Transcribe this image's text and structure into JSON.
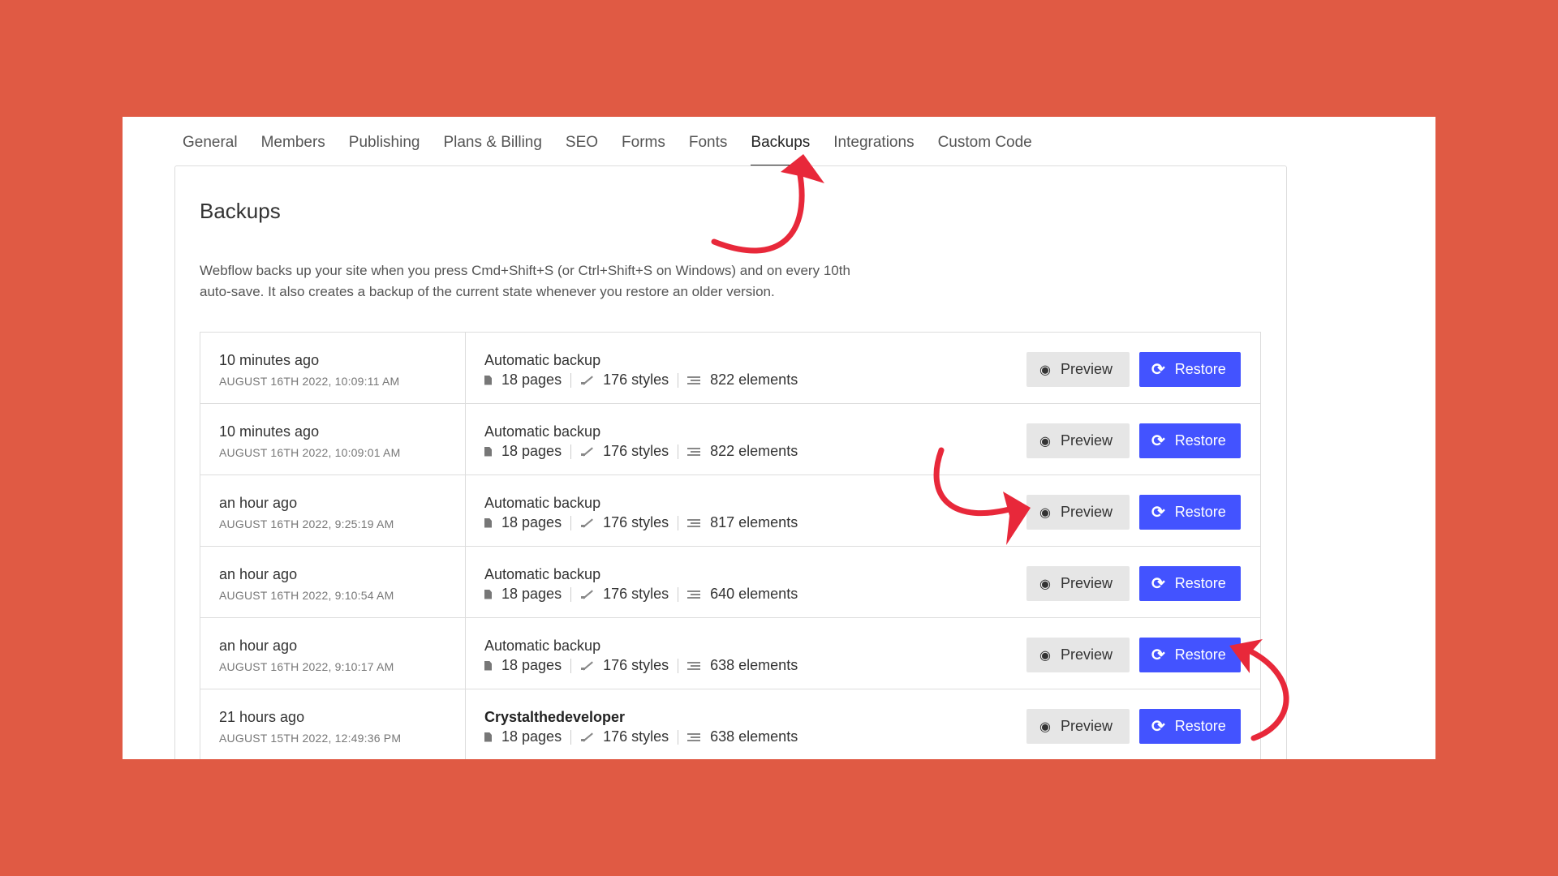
{
  "tabs": [
    "General",
    "Members",
    "Publishing",
    "Plans & Billing",
    "SEO",
    "Forms",
    "Fonts",
    "Backups",
    "Integrations",
    "Custom Code"
  ],
  "active_tab": "Backups",
  "heading": "Backups",
  "description": "Webflow backs up your site when you press Cmd+Shift+S (or Ctrl+Shift+S on Windows) and on every 10th auto-save. It also creates a backup of the current state whenever you restore an older version.",
  "buttons": {
    "preview": "Preview",
    "restore": "Restore"
  },
  "icons": {
    "preview": "eye-icon",
    "restore": "rotate-icon",
    "pages": "page-icon",
    "styles": "brush-icon",
    "elements": "list-icon"
  },
  "colors": {
    "background": "#E05A44",
    "primary": "#4353FF",
    "annotation": "#E8283A"
  },
  "backups": [
    {
      "relative": "10 minutes ago",
      "timestamp": "AUGUST 16TH 2022, 10:09:11 AM",
      "title": "Automatic backup",
      "bold": false,
      "pages": "18 pages",
      "styles": "176 styles",
      "elements": "822 elements"
    },
    {
      "relative": "10 minutes ago",
      "timestamp": "AUGUST 16TH 2022, 10:09:01 AM",
      "title": "Automatic backup",
      "bold": false,
      "pages": "18 pages",
      "styles": "176 styles",
      "elements": "822 elements"
    },
    {
      "relative": "an hour ago",
      "timestamp": "AUGUST 16TH 2022, 9:25:19 AM",
      "title": "Automatic backup",
      "bold": false,
      "pages": "18 pages",
      "styles": "176 styles",
      "elements": "817 elements"
    },
    {
      "relative": "an hour ago",
      "timestamp": "AUGUST 16TH 2022, 9:10:54 AM",
      "title": "Automatic backup",
      "bold": false,
      "pages": "18 pages",
      "styles": "176 styles",
      "elements": "640 elements"
    },
    {
      "relative": "an hour ago",
      "timestamp": "AUGUST 16TH 2022, 9:10:17 AM",
      "title": "Automatic backup",
      "bold": false,
      "pages": "18 pages",
      "styles": "176 styles",
      "elements": "638 elements"
    },
    {
      "relative": "21 hours ago",
      "timestamp": "AUGUST 15TH 2022, 12:49:36 PM",
      "title": "Crystalthedeveloper",
      "bold": true,
      "pages": "18 pages",
      "styles": "176 styles",
      "elements": "638 elements"
    }
  ]
}
